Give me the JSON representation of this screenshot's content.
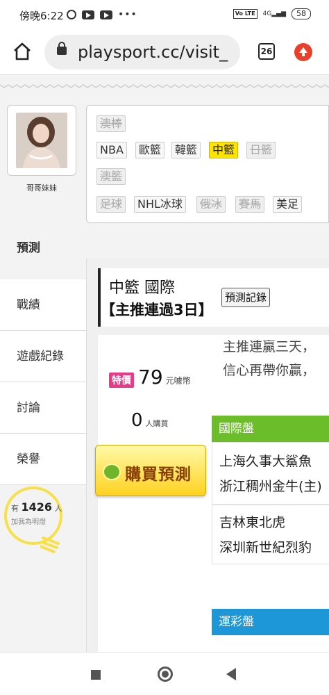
{
  "status_bar": {
    "time": "傍晚6:22",
    "network": "4G",
    "volte": "Vo LTE",
    "battery": "58"
  },
  "browser": {
    "url": "playsport.cc/visit_",
    "tab_count": "26"
  },
  "profile": {
    "name": "哥哥妹妹"
  },
  "categories": {
    "row0": [
      "澳棒"
    ],
    "row1": [
      "NBA",
      "歐籃",
      "韓籃",
      "中籃",
      "日籃"
    ],
    "row2": [
      "澳籃"
    ],
    "row3": [
      "足球",
      "NHL冰球",
      "俄冰",
      "賽馬",
      "美足"
    ],
    "active": "中籃"
  },
  "side_menu": {
    "items": [
      "預測",
      "戰績",
      "遊戲紀錄",
      "討論",
      "榮譽"
    ]
  },
  "light": {
    "prefix": "有",
    "count": "1426",
    "suffix": "人",
    "caption": "加我為明燈"
  },
  "main": {
    "title": "中籃 國際",
    "record_button": "預測記錄",
    "subtitle": "【主推連過3日】",
    "special_badge": "特價",
    "price": "79",
    "price_unit": "元噱幣",
    "buyers": "0",
    "buyers_unit": "人購買",
    "buy_button": "購買預測",
    "desc_line1": "主推連贏三天，",
    "desc_line2": "信心再帶你贏，",
    "section1": "國際盤",
    "game1_team1": "上海久事大鯊魚",
    "game1_team2": "浙江稠州金牛(主)",
    "game2_team1": "吉林東北虎",
    "game2_team2": "深圳新世紀烈豹",
    "section2": "運彩盤"
  },
  "colors": {
    "active_chip": "#ffe400",
    "section_green": "#6cbd2a",
    "section_blue": "#1e97d8",
    "special_badge": "#e8398a",
    "update_icon": "#e8402a"
  }
}
